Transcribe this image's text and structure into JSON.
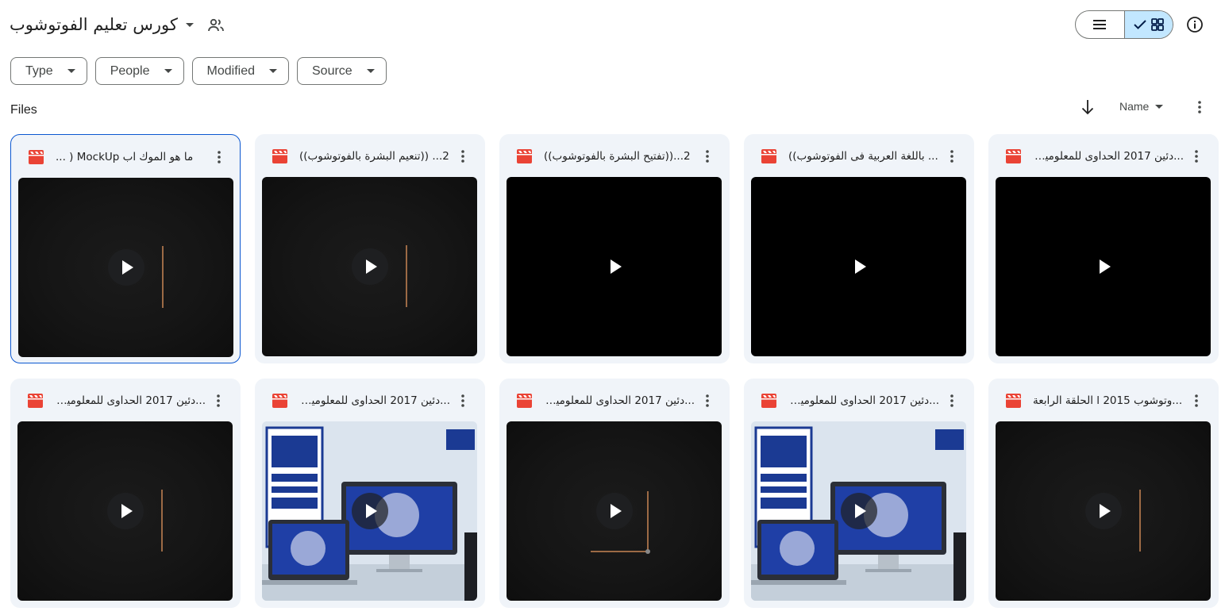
{
  "header": {
    "folder_title": "كورس تعليم الفوتوشوب",
    "icons": {
      "dropdown": "chevron-down-icon",
      "shared": "people-icon",
      "list_view": "list-view-icon",
      "grid_view": "grid-view-icon",
      "checkmark": "check-icon",
      "info": "info-icon"
    }
  },
  "filters": [
    {
      "label": "Type"
    },
    {
      "label": "People"
    },
    {
      "label": "Modified"
    },
    {
      "label": "Source"
    }
  ],
  "section": {
    "title": "Files",
    "sort_label": "Name",
    "sort_direction": "descending"
  },
  "colors": {
    "accent": "#0b57d0",
    "card_bg": "#f0f4f9",
    "selected_toggle": "#c2e7ff",
    "video_icon": "#ea4335"
  },
  "files": [
    {
      "name": "ما هو الموك اب MockUp ( ...",
      "thumb": "dark-line",
      "selected": true
    },
    {
      "name": "2... ((تنعيم البشرة بالفوتوشوب))",
      "thumb": "dark-line"
    },
    {
      "name": "2...((تفتيح البشرة بالفوتوشوب))",
      "thumb": "black"
    },
    {
      "name": "... باللغة العربية فى الفوتوشوب))",
      "thumb": "black"
    },
    {
      "name": "...دئين 2017 الحداوى للمعلوميات",
      "thumb": "black"
    },
    {
      "name": "...دئين 2017 الحداوى للمعلوميات",
      "thumb": "dark-line"
    },
    {
      "name": "...دئين 2017 الحداوى للمعلوميات",
      "thumb": "promo"
    },
    {
      "name": "...دئين 2017 الحداوى للمعلوميات",
      "thumb": "dark-corner"
    },
    {
      "name": "...دئين 2017 الحداوى للمعلوميات",
      "thumb": "promo"
    },
    {
      "name": "...وتوشوب 2015 l الحلقة الرابعة",
      "thumb": "dark-line"
    }
  ]
}
